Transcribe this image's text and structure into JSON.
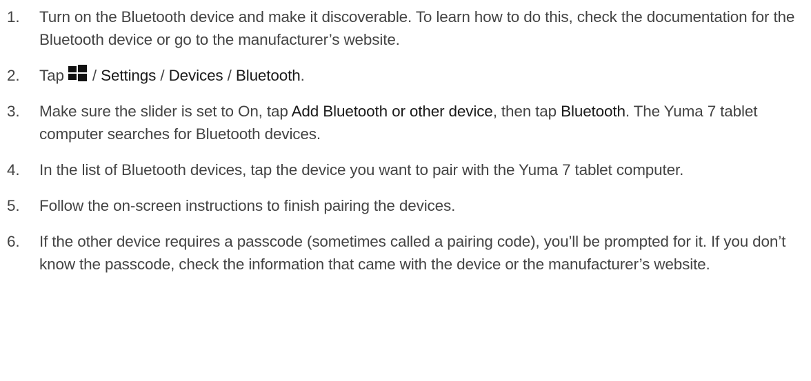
{
  "steps": [
    {
      "number": "1.",
      "text": "Turn on the Bluetooth device and make it discoverable. To learn how to do this, check the documentation for the Bluetooth device or go to the manufacturer’s website."
    },
    {
      "number": "2.",
      "tap": "Tap",
      "icon": "windows-start-icon",
      "sep1": " / ",
      "settings": "Settings",
      "sep2": " / ",
      "devices": "Devices",
      "sep3": " / ",
      "bluetooth": "Bluetooth",
      "end": "."
    },
    {
      "number": "3.",
      "pre": "Make sure the slider is set to On, tap ",
      "add_device": "Add Bluetooth or other device",
      "mid": ", then tap ",
      "bluetooth": "Bluetooth",
      "post": ". The Yuma 7 tablet computer searches for Bluetooth devices."
    },
    {
      "number": "4.",
      "text": "In the list of Bluetooth devices, tap the device you want to pair with the Yuma 7 tablet computer."
    },
    {
      "number": "5.",
      "text": "Follow the on-screen instructions to finish pairing the devices."
    },
    {
      "number": "6.",
      "text": "If the other device requires a passcode (sometimes called a pairing code), you’ll be prompted for it. If you don’t know the passcode, check the information that came with the device or the manufacturer’s website."
    }
  ],
  "colors": {
    "text": "#444444",
    "emphasis": "#1a1a1a",
    "icon": "#111111"
  }
}
